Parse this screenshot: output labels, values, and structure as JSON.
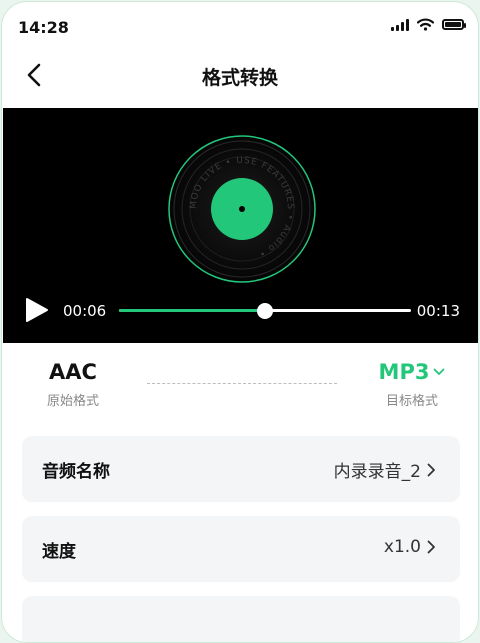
{
  "status_bar": {
    "time": "14:28"
  },
  "nav": {
    "title": "格式转换"
  },
  "player": {
    "current_time": "00:06",
    "total_time": "00:13",
    "progress": 0.5,
    "accent": "#23c77a",
    "disc_text": "MOO LIVE • USE FEATURES • Audio •"
  },
  "format": {
    "source_value": "AAC",
    "source_label": "原始格式",
    "target_value": "MP3",
    "target_label": "目标格式"
  },
  "settings": [
    {
      "label": "音频名称",
      "value": "内录录音_2"
    },
    {
      "label": "速度",
      "value": "x1.0"
    }
  ],
  "colors": {
    "accent": "#23c77a",
    "card_bg": "#f3f5f7"
  }
}
